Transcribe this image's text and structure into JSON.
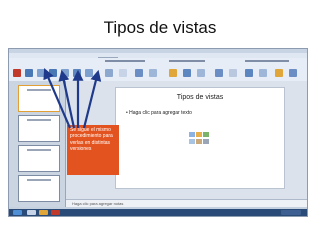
{
  "slide": {
    "title": "Tipos de vistas"
  },
  "app": {
    "slide_title": "Tipos de vistas",
    "slide_body": "• Haga clic para agregar texto",
    "notes_placeholder": "Haga clic para agregar notas",
    "callout": "Se sigue el mismo procedimiento para verlas en distintas versiones"
  },
  "colors": {
    "callout_bg": "#e3531f",
    "arrow": "#1f3a8a",
    "accent": "#2a4a78"
  }
}
